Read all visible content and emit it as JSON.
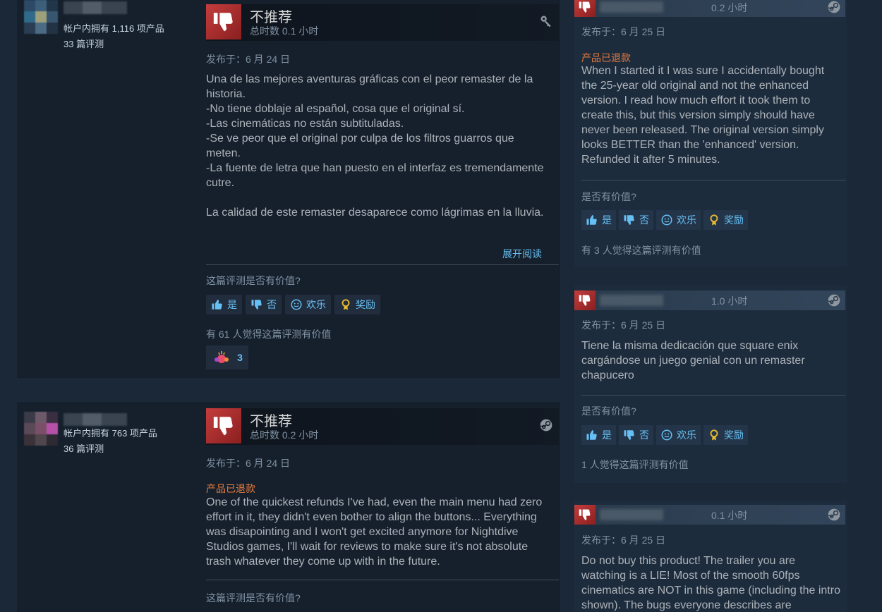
{
  "review1": {
    "owned": "帐户内拥有 1,116 项产品",
    "reviews": "33 篇评测",
    "recommendation": "不推荐",
    "hours": "总时数 0.1 小时",
    "posted": "发布于：6 月 24 日",
    "body": "Una de las mejores aventuras gráficas con el peor remaster de la historia.\n-No tiene doblaje al español, cosa que el original sí.\n-Las cinemáticas no están subtituladas.\n-Se ve peor que el original por culpa de los filtros guarros que meten.\n-La fuente de letra que han puesto en el interfaz es tremendamente cutre.\n\nLa calidad de este remaster desaparece como lágrimas en la lluvia.",
    "read_more": "展开阅读",
    "helpful_question": "这篇评测是否有价值?",
    "btn_yes": "是",
    "btn_no": "否",
    "btn_funny": "欢乐",
    "btn_award": "奖励",
    "helpful_count": "有 61 人觉得这篇评测有价值",
    "award_count": "3"
  },
  "review2": {
    "owned": "帐户内拥有 763 项产品",
    "reviews": "36 篇评测",
    "recommendation": "不推荐",
    "hours": "总时数 0.2 小时",
    "posted": "发布于：6 月 24 日",
    "refunded": "产品已退款",
    "body": "One of the quickest refunds I've had, even the main menu had zero effort in it, they didn't even bother to align the buttons... Everything was disapointing and I won't get excited anymore for Nightdive Studios games, I'll wait for reviews to make sure it's not absolute trash whatever they come up with in the future.",
    "helpful_question": "这篇评测是否有价值?"
  },
  "right1": {
    "hours": "0.2 小时",
    "posted": "发布于：6 月 25 日",
    "refunded": "产品已退款",
    "body": "When I started it I was sure I accidentally bought the 25-year old original and not the enhanced version. I read how much effort it took them to create this, but this version simply should have never been released. The original version simply looks BETTER than the 'enhanced' version. Refunded it after 5 minutes.",
    "helpful_question": "是否有价值?",
    "btn_yes": "是",
    "btn_no": "否",
    "btn_funny": "欢乐",
    "btn_award": "奖励",
    "helpful_count": "有 3 人觉得这篇评测有价值"
  },
  "right2": {
    "hours": "1.0 小时",
    "posted": "发布于：6 月 25 日",
    "body": "Tiene la misma dedicación que square enix cargándose un juego genial con un remaster chapucero",
    "helpful_question": "是否有价值?",
    "btn_yes": "是",
    "btn_no": "否",
    "btn_funny": "欢乐",
    "btn_award": "奖励",
    "helpful_count": "1 人觉得这篇评测有价值"
  },
  "right3": {
    "hours": "0.1 小时",
    "posted": "发布于：6 月 25 日",
    "body": "Do not buy this product! The trailer you are watching is a LIE! Most of the smooth 60fps cinematics are NOT in this game (including the intro shown). The bugs everyone describes are"
  },
  "colors": {
    "background": "#1b2838",
    "card": "#16202d",
    "link": "#66c0f4",
    "refund": "#e47a3d",
    "thumb_down": "#c43d3d"
  },
  "icons": [
    "thumbs-down-icon",
    "key-icon",
    "steam-icon",
    "thumbs-up-icon",
    "smiley-icon",
    "award-medal-icon"
  ]
}
